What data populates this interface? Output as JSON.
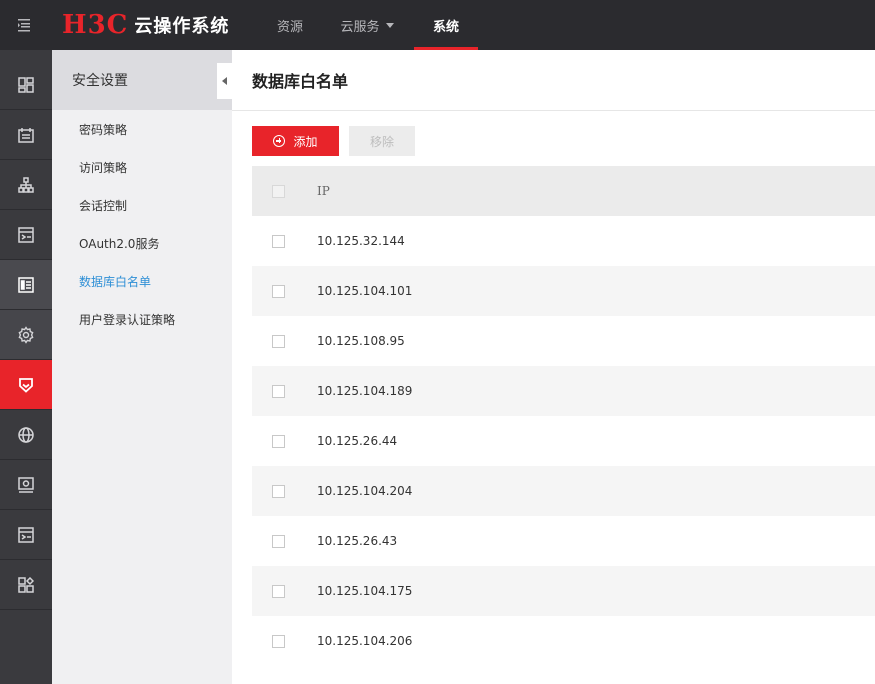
{
  "header": {
    "logo_mark": "H3C",
    "logo_text": "云操作系统",
    "nav": [
      {
        "label": "资源"
      },
      {
        "label": "云服务"
      },
      {
        "label": "系统"
      }
    ]
  },
  "iconbar": {
    "icons": [
      "dashboard-icon",
      "calendar-icon",
      "topology-icon",
      "service-list-icon",
      "report-icon",
      "gear-icon",
      "shield-icon",
      "globe-icon",
      "monitor-gear-icon",
      "list-arrow-icon",
      "apps-icon"
    ]
  },
  "subnav": {
    "title": "安全设置",
    "items": [
      {
        "label": "密码策略"
      },
      {
        "label": "访问策略"
      },
      {
        "label": "会话控制"
      },
      {
        "label": "OAuth2.0服务"
      },
      {
        "label": "数据库白名单"
      },
      {
        "label": "用户登录认证策略"
      }
    ]
  },
  "main": {
    "title": "数据库白名单",
    "add_label": "添加",
    "remove_label": "移除",
    "table": {
      "column_ip": "IP",
      "rows": [
        "10.125.32.144",
        "10.125.104.101",
        "10.125.108.95",
        "10.125.104.189",
        "10.125.26.44",
        "10.125.104.204",
        "10.125.26.43",
        "10.125.104.175",
        "10.125.104.206"
      ]
    }
  },
  "colors": {
    "accent": "#e8242a",
    "topbar": "#2b2b2f",
    "link_active": "#2e8fd6"
  }
}
